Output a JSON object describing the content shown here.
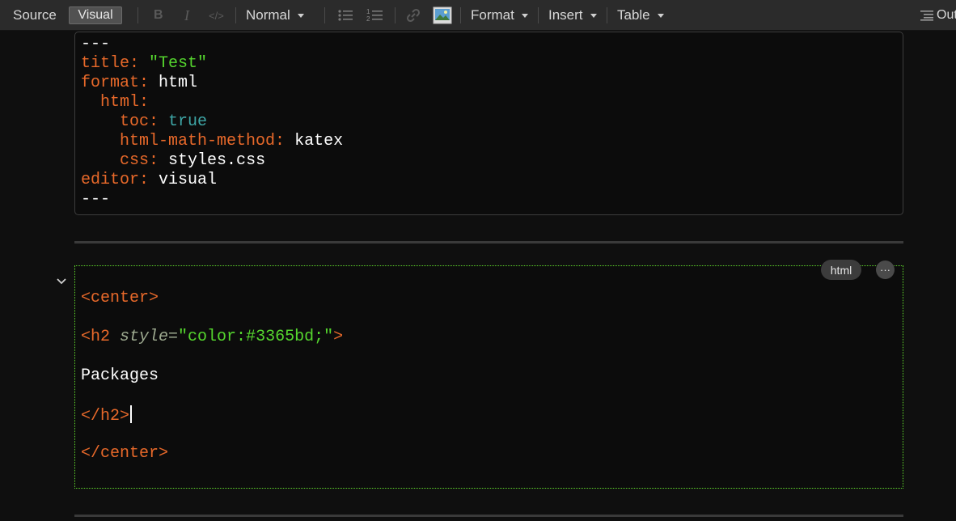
{
  "toolbar": {
    "source_label": "Source",
    "visual_label": "Visual",
    "bold_label": "B",
    "italic_label": "I",
    "code_label": "</>",
    "style_select": "Normal",
    "format_label": "Format",
    "insert_label": "Insert",
    "table_label": "Table",
    "outline_label": "Out"
  },
  "yaml": {
    "delim_open": "---",
    "title_key": "title:",
    "title_val": "\"Test\"",
    "format_key": "format:",
    "format_val": "html",
    "html_key": "html:",
    "toc_key": "toc:",
    "toc_val": "true",
    "math_key": "html-math-method:",
    "math_val": "katex",
    "css_key": "css:",
    "css_val": "styles.css",
    "editor_key": "editor:",
    "editor_val": "visual",
    "delim_close": "---"
  },
  "raw_block": {
    "chip_label": "html",
    "more_label": "···",
    "line1": "<center>",
    "line2_tag_open": "<h2 ",
    "line2_attr": "style",
    "line2_eq": "=",
    "line2_str": "\"color:#3365bd;\"",
    "line2_tag_close": ">",
    "line3": "Packages",
    "line4": "</h2>",
    "line5": "</center>"
  },
  "colors": {
    "keyword": "#e8692a",
    "string": "#55d62e",
    "boolean": "#3ea6a6",
    "raw_border": "#5fd62b"
  }
}
